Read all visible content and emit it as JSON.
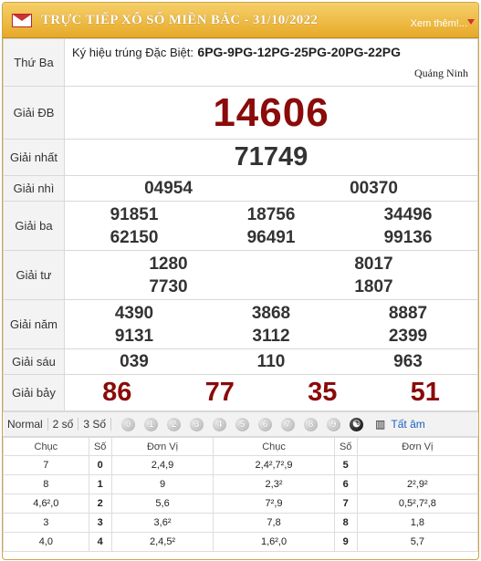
{
  "header": {
    "title": "TRỰC TIẾP XỔ SỐ MIỀN BẮC - 31/10/2022",
    "more": "Xem thêm!..."
  },
  "info": {
    "day": "Thứ Ba",
    "special_code_label": "Ký hiệu trúng Đặc Biệt:",
    "special_code": "6PG-9PG-12PG-25PG-20PG-22PG",
    "province": "Quảng Ninh"
  },
  "prizes": {
    "db": {
      "label": "Giải ĐB",
      "value": "14606"
    },
    "nhat": {
      "label": "Giải nhất",
      "value": "71749"
    },
    "nhi": {
      "label": "Giải nhì",
      "values": [
        "04954",
        "00370"
      ]
    },
    "ba": {
      "label": "Giải ba",
      "values": [
        "91851",
        "18756",
        "34496",
        "62150",
        "96491",
        "99136"
      ]
    },
    "tu": {
      "label": "Giải tư",
      "values": [
        "1280",
        "8017",
        "7730",
        "1807"
      ]
    },
    "nam": {
      "label": "Giải năm",
      "values": [
        "4390",
        "3868",
        "8887",
        "9131",
        "3112",
        "2399"
      ]
    },
    "sau": {
      "label": "Giải sáu",
      "values": [
        "039",
        "110",
        "963"
      ]
    },
    "bay": {
      "label": "Giải bảy",
      "values": [
        "86",
        "77",
        "35",
        "51"
      ]
    }
  },
  "toolbar": {
    "normal": "Normal",
    "two": "2 số",
    "three": "3 Số",
    "digits": [
      "0",
      "1",
      "2",
      "3",
      "4",
      "5",
      "6",
      "7",
      "8",
      "9"
    ],
    "all": "Tất âm"
  },
  "loto": {
    "headers": [
      "Chục",
      "Số",
      "Đơn Vị",
      "Chục",
      "Số",
      "Đơn Vị"
    ],
    "rows": [
      [
        "7",
        "0",
        "2,4,9",
        "2,4²,7²,9",
        "5",
        ""
      ],
      [
        "8",
        "1",
        "9",
        "2,3²",
        "6",
        "2²,9²"
      ],
      [
        "4,6²,0",
        "2",
        "5,6",
        "7²,9",
        "7",
        "0,5²,7²,8"
      ],
      [
        "3",
        "3",
        "3,6²",
        "7,8",
        "8",
        "1,8"
      ],
      [
        "4,0",
        "4",
        "2,4,5²",
        "1,6²,0",
        "9",
        "5,7"
      ]
    ]
  }
}
